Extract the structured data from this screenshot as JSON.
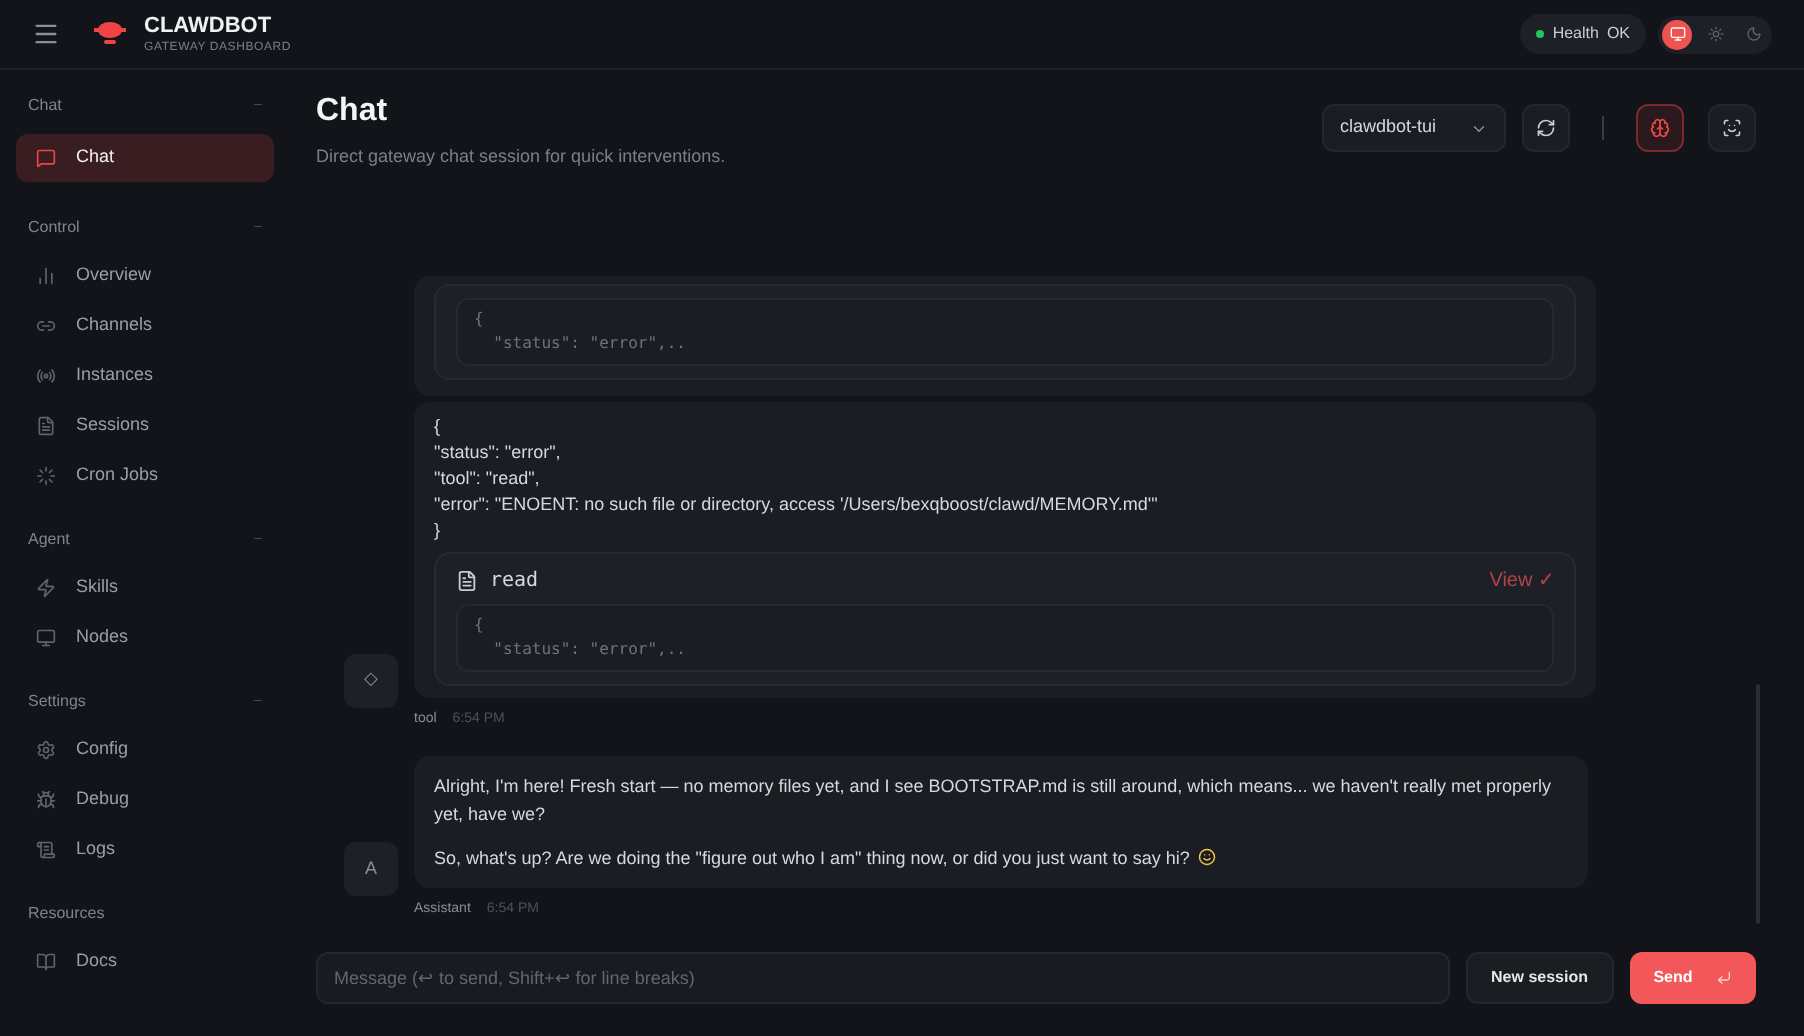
{
  "brand": {
    "name": "CLAWDBOT",
    "subtitle": "GATEWAY DASHBOARD"
  },
  "health": {
    "label": "Health",
    "value": "OK",
    "ok": true
  },
  "theme_modes": [
    {
      "kind": "system",
      "selected": true
    },
    {
      "kind": "light",
      "selected": false
    },
    {
      "kind": "dark",
      "selected": false
    }
  ],
  "sidebar": [
    {
      "title": "Chat",
      "toggle": "–",
      "items": [
        {
          "label": "Chat",
          "kind": "chat",
          "selected": true
        }
      ]
    },
    {
      "title": "Control",
      "toggle": "–",
      "items": [
        {
          "label": "Overview",
          "kind": "bars",
          "selected": false
        },
        {
          "label": "Channels",
          "kind": "link",
          "selected": false
        },
        {
          "label": "Instances",
          "kind": "radio",
          "selected": false
        },
        {
          "label": "Sessions",
          "kind": "file",
          "selected": false
        },
        {
          "label": "Cron Jobs",
          "kind": "loader",
          "selected": false
        }
      ]
    },
    {
      "title": "Agent",
      "toggle": "–",
      "items": [
        {
          "label": "Skills",
          "kind": "zap",
          "selected": false
        },
        {
          "label": "Nodes",
          "kind": "monitor",
          "selected": false
        }
      ]
    },
    {
      "title": "Settings",
      "toggle": "–",
      "items": [
        {
          "label": "Config",
          "kind": "gear",
          "selected": false
        },
        {
          "label": "Debug",
          "kind": "bug",
          "selected": false
        },
        {
          "label": "Logs",
          "kind": "scroll",
          "selected": false
        }
      ]
    },
    {
      "title": "Resources",
      "items": [
        {
          "label": "Docs",
          "kind": "book",
          "selected": false
        }
      ]
    }
  ],
  "page": {
    "title": "Chat",
    "subtitle": "Direct gateway chat session for quick interventions."
  },
  "session_select": {
    "value": "clawdbot-tui"
  },
  "thinking_toggle": {
    "on": true
  },
  "messages": [
    {
      "kind": "tool",
      "avatar": "◇",
      "author": "tool",
      "time": "6:54 PM",
      "cards": [
        {
          "kind": "tool_partial",
          "code": [
            "{",
            "  \"status\": \"error\",.."
          ]
        },
        {
          "kind": "text",
          "lines": [
            "{",
            "\"status\": \"error\",",
            "\"tool\": \"read\",",
            "\"error\": \"ENOENT: no such file or directory, access '/Users/bexqboost/clawd/MEMORY.md'\"",
            "}"
          ],
          "tool": {
            "name": "read",
            "action": "View ✓",
            "code": [
              "{",
              "  \"status\": \"error\",.."
            ]
          }
        }
      ]
    },
    {
      "kind": "assistant",
      "avatar": "A",
      "author": "Assistant",
      "time": "6:54 PM",
      "paragraphs": [
        "Alright, I'm here! Fresh start — no memory files yet, and I see BOOTSTRAP.md is still around, which means... we haven't really met properly yet, have we?",
        "So, what's up? Are we doing the \"figure out who I am\" thing now, or did you just want to say hi?"
      ],
      "emoji": true
    }
  ],
  "composer": {
    "placeholder": "Message (↩ to send, Shift+↩ for line breaks)",
    "new_session": "New session",
    "send": "Send"
  }
}
